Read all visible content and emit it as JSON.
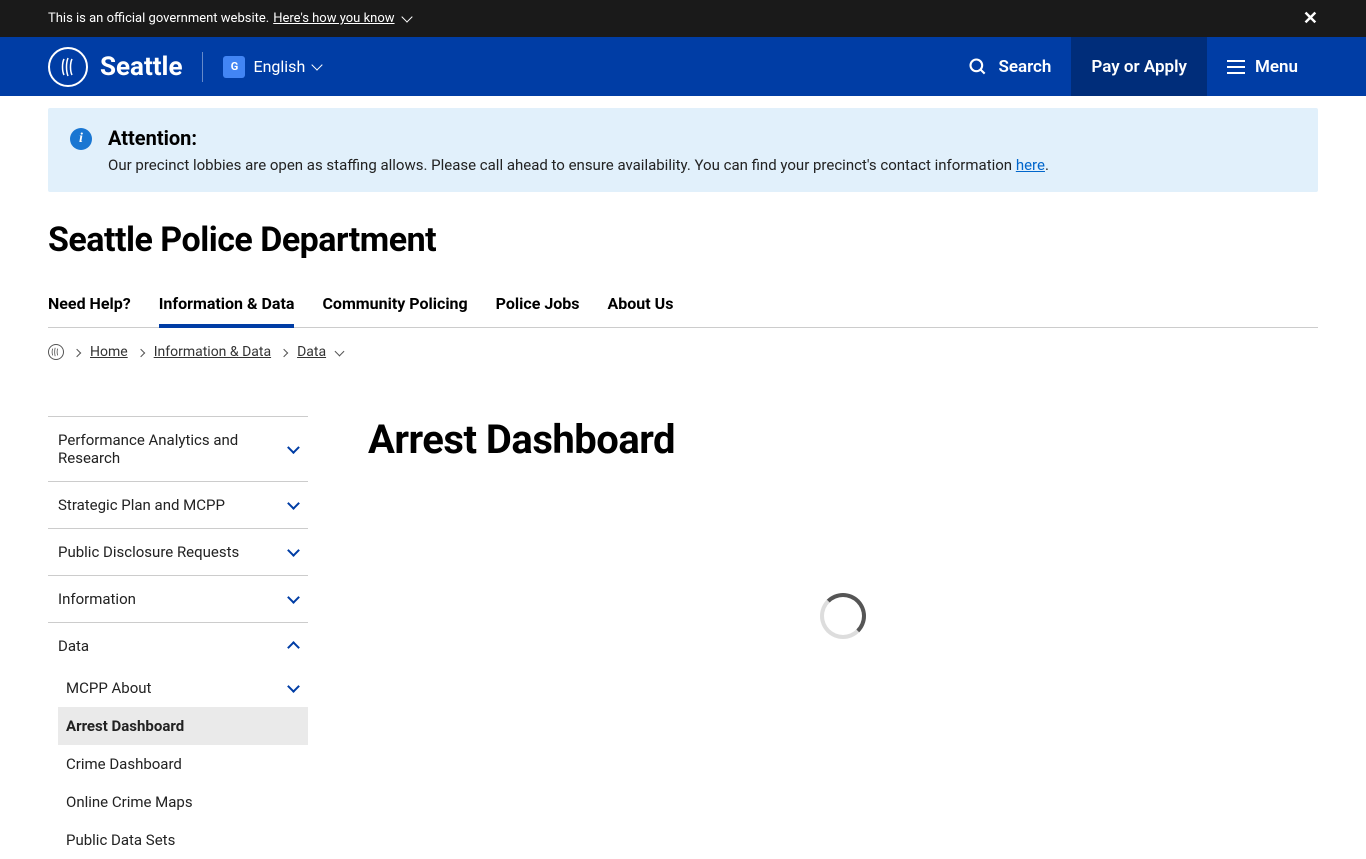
{
  "gov_banner": {
    "text": "This is an official government website.",
    "link_text": "Here's how you know"
  },
  "header": {
    "city_name": "Seattle",
    "language": "English",
    "search_label": "Search",
    "pay_apply_label": "Pay or Apply",
    "menu_label": "Menu"
  },
  "alert": {
    "title": "Attention:",
    "message_before": "Our precinct lobbies are open as staffing allows. Please call ahead to ensure availability. You can find your precinct's contact information ",
    "link_text": "here",
    "message_after": "."
  },
  "department_title": "Seattle Police Department",
  "tabs": [
    {
      "label": "Need Help?",
      "active": false
    },
    {
      "label": "Information & Data",
      "active": true
    },
    {
      "label": "Community Policing",
      "active": false
    },
    {
      "label": "Police Jobs",
      "active": false
    },
    {
      "label": "About Us",
      "active": false
    }
  ],
  "breadcrumb": {
    "items": [
      {
        "label": "Home"
      },
      {
        "label": "Information & Data"
      },
      {
        "label": "Data"
      }
    ]
  },
  "sidebar": {
    "items": [
      {
        "label": "Performance Analytics and Research",
        "expanded": false
      },
      {
        "label": "Strategic Plan and MCPP",
        "expanded": false
      },
      {
        "label": "Public Disclosure Requests",
        "expanded": false
      },
      {
        "label": "Information",
        "expanded": false
      },
      {
        "label": "Data",
        "expanded": true
      }
    ],
    "sub_items": [
      {
        "label": "MCPP About",
        "has_chevron": true,
        "active": false
      },
      {
        "label": "Arrest Dashboard",
        "has_chevron": false,
        "active": true
      },
      {
        "label": "Crime Dashboard",
        "has_chevron": false,
        "active": false
      },
      {
        "label": "Online Crime Maps",
        "has_chevron": false,
        "active": false
      },
      {
        "label": "Public Data Sets",
        "has_chevron": false,
        "active": false
      }
    ]
  },
  "page_heading": "Arrest Dashboard"
}
